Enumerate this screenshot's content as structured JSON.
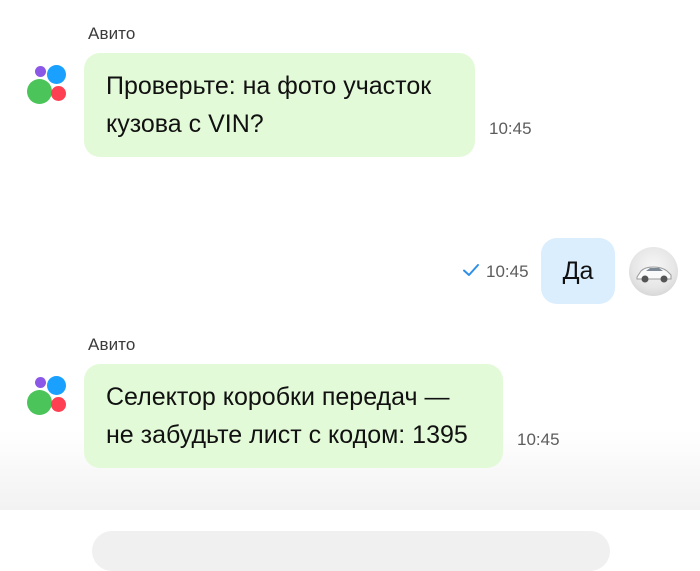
{
  "messages": [
    {
      "sender": "Авито",
      "lines": [
        "Проверьте: на фото участок",
        "кузова с VIN?"
      ],
      "time": "10:45"
    },
    {
      "text": "Да",
      "time": "10:45"
    },
    {
      "sender": "Авито",
      "lines": [
        "Селектор коробки передач —",
        "не забудьте лист с кодом: 1395"
      ],
      "time": "10:45"
    }
  ],
  "colors": {
    "incoming_bubble": "#e3fad8",
    "outgoing_bubble": "#dbeefe",
    "read_check": "#2f8fe6"
  },
  "icons": {
    "sender_avatar": "avito-logo-icon",
    "read_status": "checkmark-icon",
    "user_avatar": "user-photo-avatar"
  }
}
